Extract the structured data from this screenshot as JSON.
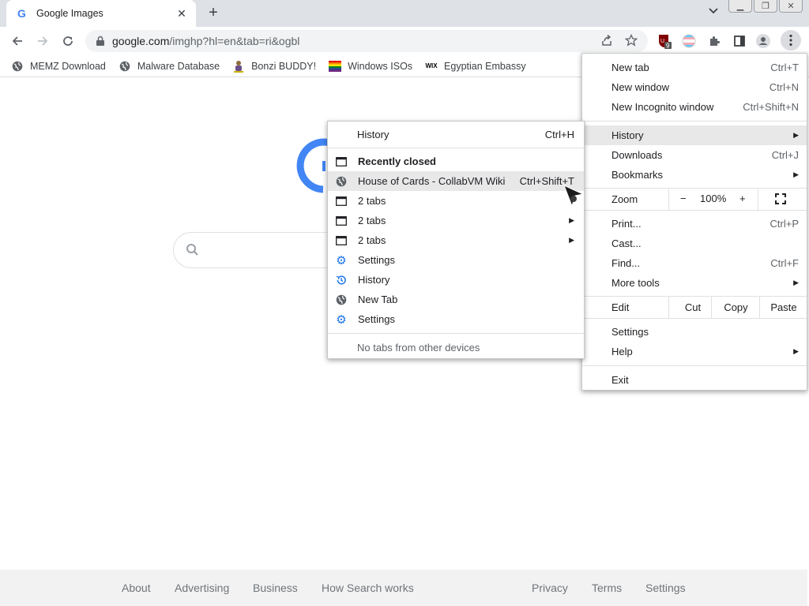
{
  "browser": {
    "tab": {
      "title": "Google Images",
      "favicon": "G"
    },
    "omnibox": {
      "host": "google.com",
      "path": "/imghp?hl=en&tab=ri&ogbl"
    },
    "extension_badge": "9"
  },
  "bookmarks": [
    {
      "label": "MEMZ Download",
      "icon": "globe-icon"
    },
    {
      "label": "Malware Database",
      "icon": "globe-icon"
    },
    {
      "label": "Bonzi BUDDY!",
      "icon": "bonzi-icon"
    },
    {
      "label": "Windows ISOs",
      "icon": "rainbow-flag-icon"
    },
    {
      "label": "Egyptian Embassy",
      "icon": "wix-icon"
    }
  ],
  "menu": {
    "new_tab": {
      "label": "New tab",
      "shortcut": "Ctrl+T"
    },
    "new_window": {
      "label": "New window",
      "shortcut": "Ctrl+N"
    },
    "new_incognito": {
      "label": "New Incognito window",
      "shortcut": "Ctrl+Shift+N"
    },
    "history": {
      "label": "History"
    },
    "downloads": {
      "label": "Downloads",
      "shortcut": "Ctrl+J"
    },
    "bookmarks": {
      "label": "Bookmarks"
    },
    "zoom": {
      "label": "Zoom",
      "minus": "−",
      "value": "100%",
      "plus": "+"
    },
    "print": {
      "label": "Print...",
      "shortcut": "Ctrl+P"
    },
    "cast": {
      "label": "Cast..."
    },
    "find": {
      "label": "Find...",
      "shortcut": "Ctrl+F"
    },
    "more_tools": {
      "label": "More tools"
    },
    "edit": {
      "label": "Edit",
      "cut": "Cut",
      "copy": "Copy",
      "paste": "Paste"
    },
    "settings": {
      "label": "Settings"
    },
    "help": {
      "label": "Help"
    },
    "exit": {
      "label": "Exit"
    }
  },
  "history_submenu": {
    "history": {
      "label": "History",
      "shortcut": "Ctrl+H"
    },
    "recently_closed": "Recently closed",
    "items": [
      {
        "label": "House of Cards - CollabVM Wiki",
        "shortcut": "Ctrl+Shift+T",
        "icon": "globe-icon"
      },
      {
        "label": "2 tabs",
        "icon": "window-icon"
      },
      {
        "label": "2 tabs",
        "icon": "window-icon"
      },
      {
        "label": "2 tabs",
        "icon": "window-icon"
      },
      {
        "label": "Settings",
        "icon": "gear-icon"
      },
      {
        "label": "History",
        "icon": "history-icon"
      },
      {
        "label": "New Tab",
        "icon": "globe-icon"
      },
      {
        "label": "Settings",
        "icon": "gear-icon"
      }
    ],
    "no_tabs": "No tabs from other devices"
  },
  "footer": {
    "about": "About",
    "advertising": "Advertising",
    "business": "Business",
    "how_search_works": "How Search works",
    "privacy": "Privacy",
    "terms": "Terms",
    "settings": "Settings"
  },
  "colors": {
    "google_blue": "#4285f4",
    "menu_hover": "#e8e8e9",
    "tabstrip": "#dee1e6"
  }
}
